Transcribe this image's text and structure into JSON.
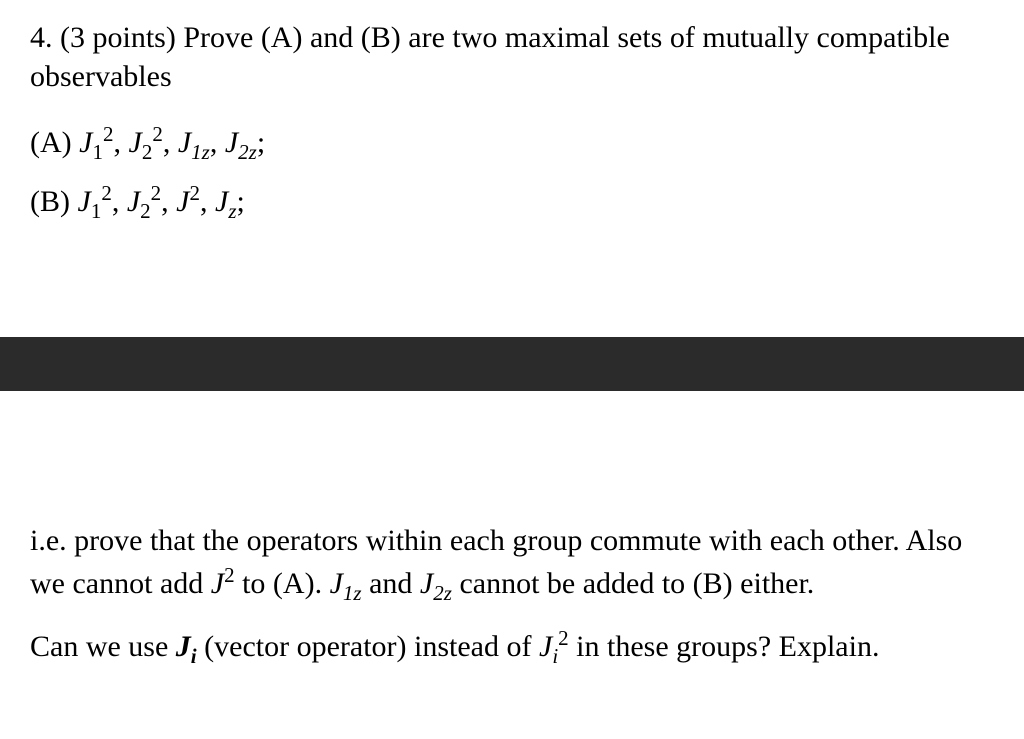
{
  "problem": {
    "number_points": "4. (3 points) ",
    "statement": "Prove (A) and (B) are two maximal sets of mutually compatible observables",
    "setA_label": "(A) ",
    "setB_label": "(B) ",
    "clarification_line1": "i.e. prove that the operators within each group commute with each other. Also we cannot add ",
    "clarification_mid1": " to (A). ",
    "clarification_mid2": " and ",
    "clarification_mid3": " cannot be added to (B) either.",
    "question_part1": "Can we use ",
    "question_part2": " (vector operator) instead of ",
    "question_part3": " in these groups? Explain."
  },
  "math": {
    "J": "J",
    "sq": "2",
    "sub1": "1",
    "sub2": "2",
    "subz": "z",
    "sub1z": "1z",
    "sub2z": "2z",
    "subi": "i",
    "comma": ", ",
    "semicolon": ";"
  }
}
